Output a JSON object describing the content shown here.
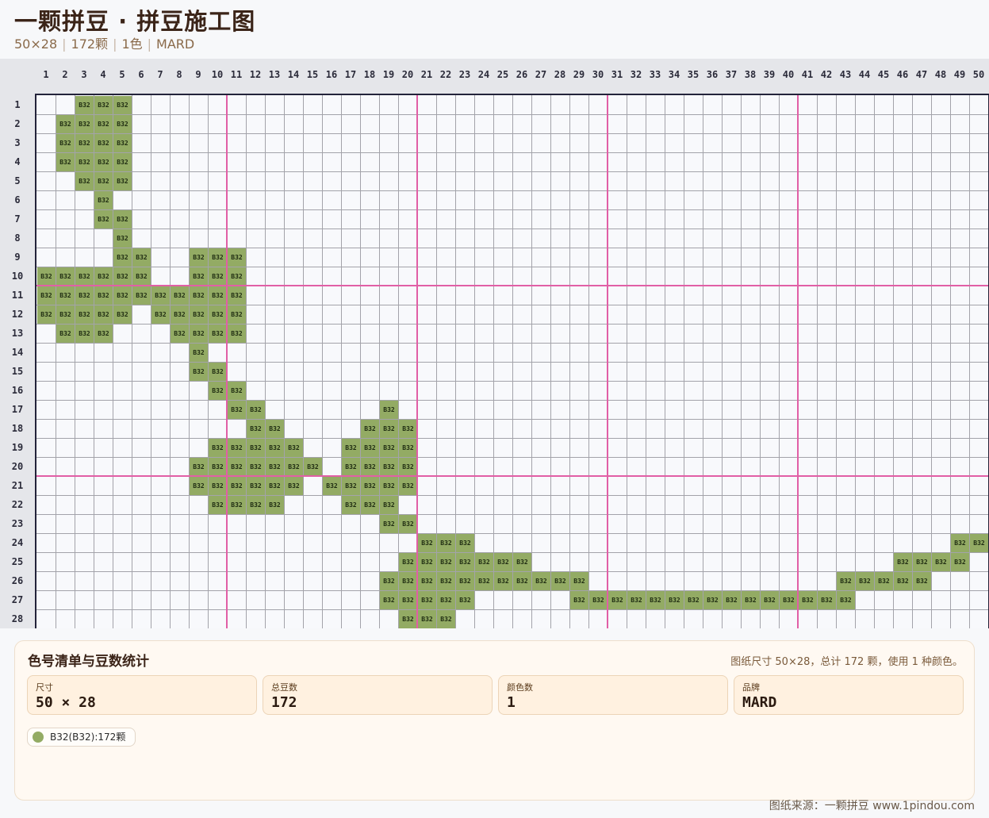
{
  "header": {
    "title": "一颗拼豆 · 拼豆施工图",
    "meta": [
      "50×28",
      "172颗",
      "1色",
      "MARD"
    ]
  },
  "pattern": {
    "columns": 50,
    "rows": 28,
    "bead_code": "B32",
    "bead_color": "#93ab64",
    "empty_color": "#f8f9fc",
    "grid_line_color": "#a3a3aa",
    "major_line_color": "#e15fa6",
    "major_every": 10,
    "col_labels": [
      "1",
      "2",
      "3",
      "4",
      "5",
      "6",
      "7",
      "8",
      "9",
      "10",
      "11",
      "12",
      "13",
      "14",
      "15",
      "16",
      "17",
      "18",
      "19",
      "20",
      "21",
      "22",
      "23",
      "24",
      "25",
      "26",
      "27",
      "28",
      "29",
      "30",
      "31",
      "32",
      "33",
      "34",
      "35",
      "36",
      "37",
      "38",
      "39",
      "40",
      "41",
      "42",
      "43",
      "44",
      "45",
      "46",
      "47",
      "48",
      "49",
      "50"
    ],
    "row_labels": [
      "1",
      "2",
      "3",
      "4",
      "5",
      "6",
      "7",
      "8",
      "9",
      "10",
      "11",
      "12",
      "13",
      "14",
      "15",
      "16",
      "17",
      "18",
      "19",
      "20",
      "21",
      "22",
      "23",
      "24",
      "25",
      "26",
      "27",
      "28"
    ],
    "cells": [
      [
        3,
        4,
        5
      ],
      [
        2,
        3,
        4,
        5
      ],
      [
        2,
        3,
        4,
        5
      ],
      [
        2,
        3,
        4,
        5
      ],
      [
        3,
        4,
        5
      ],
      [
        4
      ],
      [
        4,
        5
      ],
      [
        5
      ],
      [
        5,
        6,
        9,
        10,
        11
      ],
      [
        1,
        2,
        3,
        4,
        5,
        6,
        9,
        10,
        11
      ],
      [
        1,
        2,
        3,
        4,
        5,
        6,
        7,
        8,
        9,
        10,
        11
      ],
      [
        1,
        2,
        3,
        4,
        5,
        7,
        8,
        9,
        10,
        11
      ],
      [
        2,
        3,
        4,
        8,
        9,
        10,
        11
      ],
      [
        9
      ],
      [
        9,
        10
      ],
      [
        10,
        11
      ],
      [
        11,
        12,
        19
      ],
      [
        12,
        13,
        18,
        19,
        20
      ],
      [
        10,
        11,
        12,
        13,
        14,
        17,
        18,
        19,
        20
      ],
      [
        9,
        10,
        11,
        12,
        13,
        14,
        15,
        17,
        18,
        19,
        20
      ],
      [
        9,
        10,
        11,
        12,
        13,
        14,
        16,
        17,
        18,
        19,
        20
      ],
      [
        10,
        11,
        12,
        13,
        17,
        18,
        19
      ],
      [
        19,
        20
      ],
      [
        21,
        22,
        23,
        49,
        50
      ],
      [
        20,
        21,
        22,
        23,
        24,
        25,
        26,
        46,
        47,
        48,
        49
      ],
      [
        19,
        20,
        21,
        22,
        23,
        24,
        25,
        26,
        27,
        28,
        29,
        43,
        44,
        45,
        46,
        47
      ],
      [
        19,
        20,
        21,
        22,
        23,
        29,
        30,
        31,
        32,
        33,
        34,
        35,
        36,
        37,
        38,
        39,
        40,
        41,
        42,
        43
      ],
      [
        20,
        21,
        22
      ]
    ]
  },
  "panel": {
    "title": "色号清单与豆数统计",
    "summary": "图纸尺寸 50×28，总计 172 颗，使用 1 种颜色。",
    "stats": [
      {
        "label": "尺寸",
        "value": "50 × 28"
      },
      {
        "label": "总豆数",
        "value": "172"
      },
      {
        "label": "颜色数",
        "value": "1"
      },
      {
        "label": "品牌",
        "value": "MARD"
      }
    ],
    "colors": [
      {
        "label": "B32(B32):172颗",
        "color": "#93ab64"
      }
    ]
  },
  "footer": {
    "source": "图纸来源：一颗拼豆 www.1pindou.com"
  }
}
